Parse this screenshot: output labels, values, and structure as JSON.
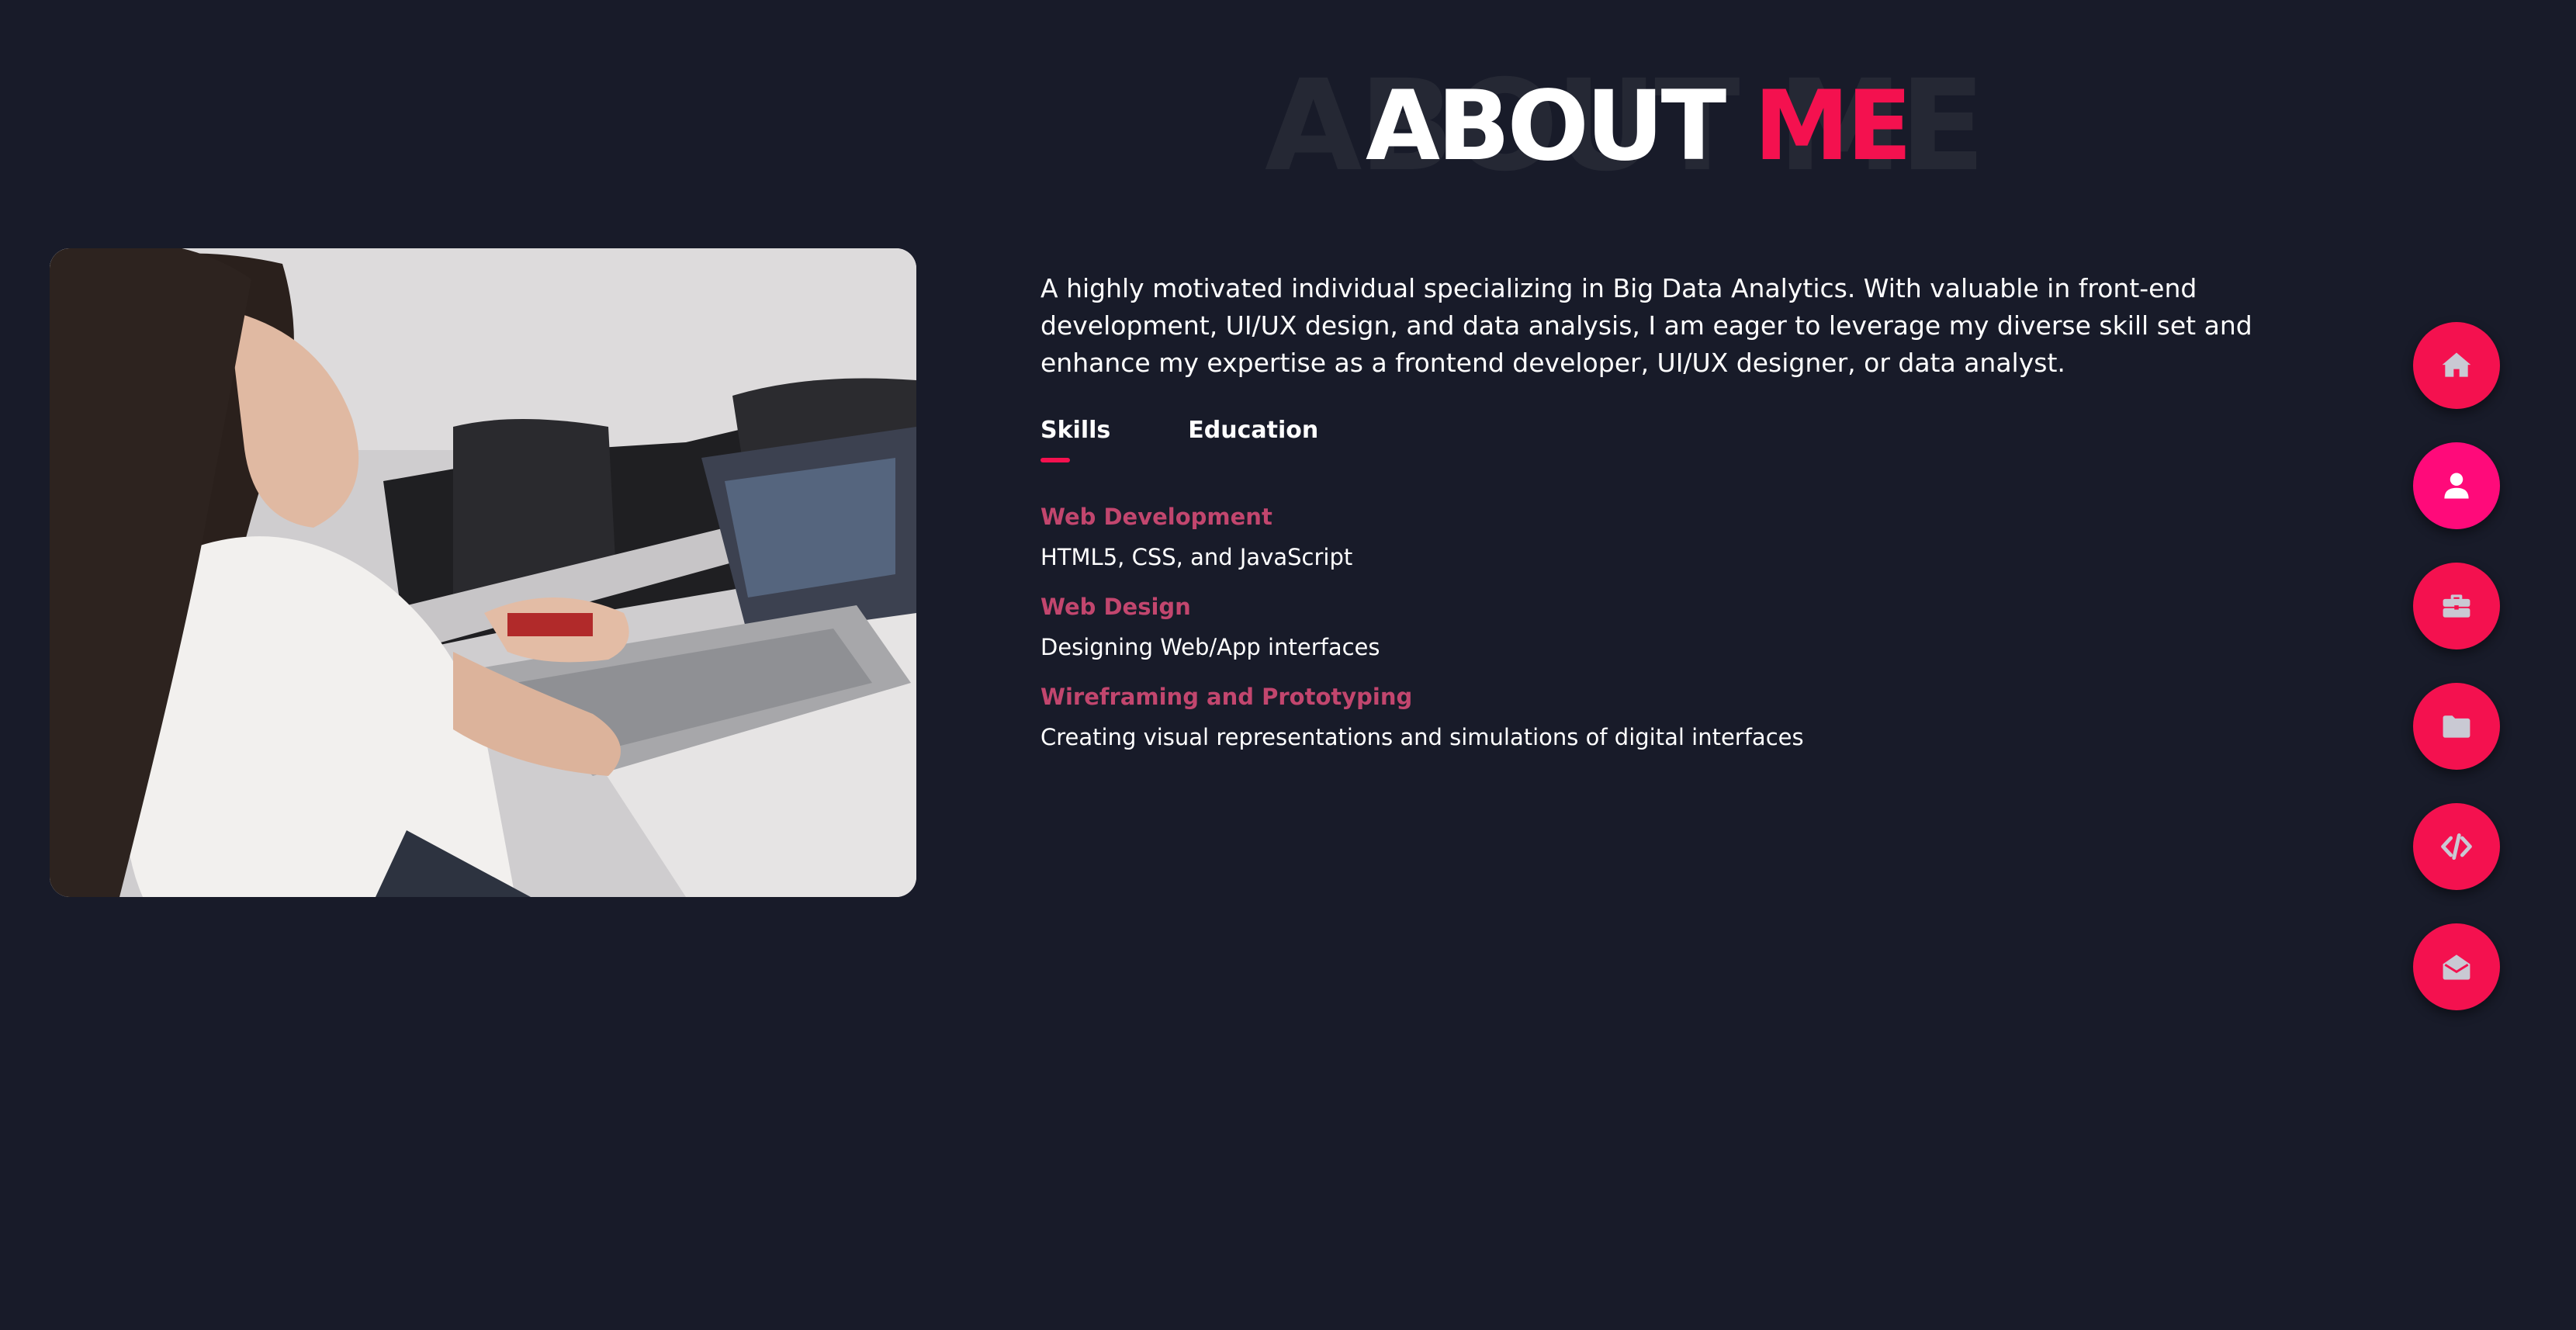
{
  "heading": {
    "ghost": "ABOUT ME",
    "main_part1": "ABOUT",
    "main_part2": "ME"
  },
  "photo": {
    "alt": "Woman typing on a laptop"
  },
  "about": {
    "bio": "A highly motivated individual specializing in Big Data Analytics. With valuable in front-end development, UI/UX design, and data analysis, I am eager to leverage my diverse skill set and enhance my expertise as a frontend developer, UI/UX designer, or data analyst."
  },
  "tabs": [
    {
      "label": "Skills",
      "active": true
    },
    {
      "label": "Education",
      "active": false
    }
  ],
  "skills": [
    {
      "title": "Web Development",
      "desc": "HTML5, CSS, and JavaScript"
    },
    {
      "title": "Web Design",
      "desc": "Designing Web/App interfaces"
    },
    {
      "title": "Wireframing and Prototyping",
      "desc": "Creating visual representations and simulations of digital interfaces"
    }
  ],
  "sidenav": [
    {
      "icon": "home-icon",
      "active": false
    },
    {
      "icon": "user-icon",
      "active": true
    },
    {
      "icon": "briefcase-icon",
      "active": false
    },
    {
      "icon": "folder-icon",
      "active": false
    },
    {
      "icon": "code-icon",
      "active": false
    },
    {
      "icon": "envelope-open-icon",
      "active": false
    }
  ],
  "colors": {
    "background": "#181b29",
    "accent": "#f4114f",
    "accent_active": "#ff0a7a",
    "skill_title": "#c2466e",
    "heading_ghost": "#252834"
  }
}
